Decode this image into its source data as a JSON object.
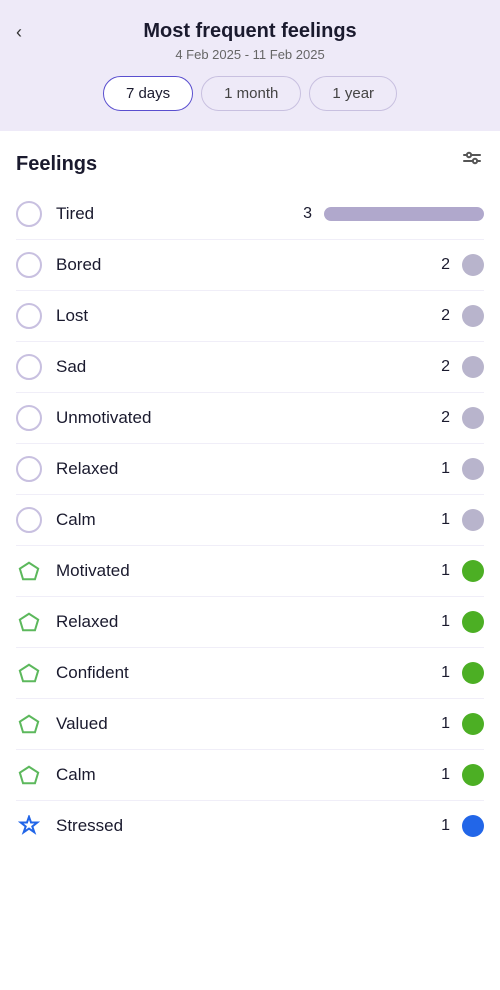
{
  "header": {
    "title": "Most frequent feelings",
    "date_range": "4 Feb 2025 - 11 Feb 2025",
    "back_label": "‹"
  },
  "tabs": [
    {
      "label": "7 days",
      "active": true
    },
    {
      "label": "1 month",
      "active": false
    },
    {
      "label": "1 year",
      "active": false
    }
  ],
  "section": {
    "title": "Feelings",
    "filter_icon": "⇌"
  },
  "feelings": [
    {
      "name": "Tired",
      "count": 3,
      "icon": "radio",
      "color": "gray",
      "bar": true,
      "bar_pct": 100
    },
    {
      "name": "Bored",
      "count": 2,
      "icon": "radio",
      "color": "gray",
      "bar": false
    },
    {
      "name": "Lost",
      "count": 2,
      "icon": "radio",
      "color": "gray",
      "bar": false
    },
    {
      "name": "Sad",
      "count": 2,
      "icon": "radio",
      "color": "gray",
      "bar": false
    },
    {
      "name": "Unmotivated",
      "count": 2,
      "icon": "radio",
      "color": "gray",
      "bar": false
    },
    {
      "name": "Relaxed",
      "count": 1,
      "icon": "radio",
      "color": "gray",
      "bar": false
    },
    {
      "name": "Calm",
      "count": 1,
      "icon": "radio",
      "color": "gray",
      "bar": false
    },
    {
      "name": "Motivated",
      "count": 1,
      "icon": "pentagon",
      "color": "green",
      "bar": false
    },
    {
      "name": "Relaxed",
      "count": 1,
      "icon": "pentagon",
      "color": "green",
      "bar": false
    },
    {
      "name": "Confident",
      "count": 1,
      "icon": "pentagon",
      "color": "green",
      "bar": false
    },
    {
      "name": "Valued",
      "count": 1,
      "icon": "pentagon",
      "color": "green",
      "bar": false
    },
    {
      "name": "Calm",
      "count": 1,
      "icon": "pentagon",
      "color": "green",
      "bar": false
    },
    {
      "name": "Stressed",
      "count": 1,
      "icon": "star",
      "color": "blue",
      "bar": false
    }
  ]
}
